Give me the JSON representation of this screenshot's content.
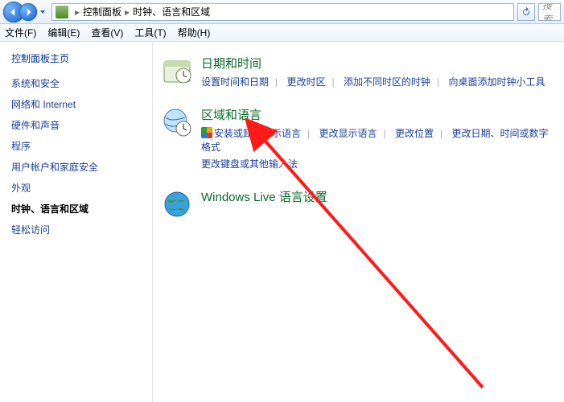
{
  "addressbar": {
    "crumb1": "控制面板",
    "crumb2": "时钟、语言和区域",
    "search_placeholder": "搜索"
  },
  "menubar": {
    "file": "文件(F)",
    "edit": "编辑(E)",
    "view": "查看(V)",
    "tools": "工具(T)",
    "help": "帮助(H)"
  },
  "sidebar": {
    "home": "控制面板主页",
    "items": [
      "系统和安全",
      "网络和 Internet",
      "硬件和声音",
      "程序",
      "用户帐户和家庭安全",
      "外观",
      "时钟、语言和区域",
      "轻松访问"
    ]
  },
  "categories": [
    {
      "title": "日期和时间",
      "links": [
        {
          "label": "设置时间和日期",
          "shield": false
        },
        {
          "label": "更改时区",
          "shield": false
        },
        {
          "label": "添加不同时区的时钟",
          "shield": false
        },
        {
          "label": "向桌面添加时钟小工具",
          "shield": false
        }
      ],
      "second_row": []
    },
    {
      "title": "区域和语言",
      "links": [
        {
          "label": "安装或卸载显示语言",
          "shield": true
        },
        {
          "label": "更改显示语言",
          "shield": false
        },
        {
          "label": "更改位置",
          "shield": false
        },
        {
          "label": "更改日期、时间或数字格式",
          "shield": false
        }
      ],
      "second_row": [
        {
          "label": "更改键盘或其他输入法",
          "shield": false
        }
      ]
    },
    {
      "title": "Windows Live 语言设置",
      "links": [],
      "second_row": []
    }
  ]
}
